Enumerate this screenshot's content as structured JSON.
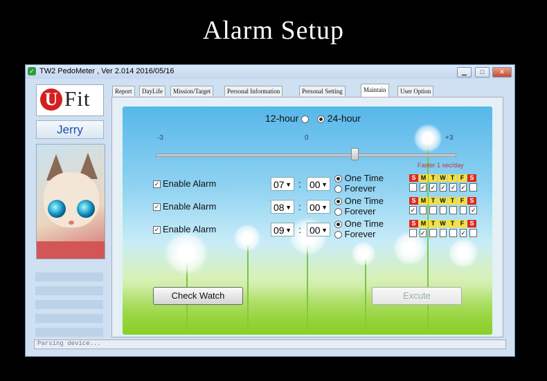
{
  "page_title": "Alarm Setup",
  "window": {
    "title": "TW2  PedoMeter , Ver 2.014   2016/05/16",
    "min_icon": "minimize-icon",
    "max_icon": "maximize-icon",
    "close_icon": "close-icon"
  },
  "sidebar": {
    "logo_u": "U",
    "logo_fit": "Fit",
    "username": "Jerry"
  },
  "tabs": [
    {
      "label": "Report"
    },
    {
      "label": "DayLife"
    },
    {
      "label": "Mission/Target"
    },
    {
      "label": "Personal Information"
    },
    {
      "label": "Personal Setting"
    },
    {
      "label": "Maintain"
    },
    {
      "label": "User Option"
    }
  ],
  "active_tab": "Maintain",
  "clock": {
    "opt_12": "12-hour",
    "opt_24": "24-hour",
    "selected": "24-hour"
  },
  "time_adjust": {
    "min_label": "-3",
    "mid_label": "0",
    "max_label": "+3",
    "value": 1,
    "hint": "Faster 1 sec/day"
  },
  "days_header": [
    "S",
    "M",
    "T",
    "W",
    "T",
    "F",
    "S"
  ],
  "alarms": [
    {
      "enable_label": "Enable Alarm",
      "enabled": true,
      "hour": "07",
      "minute": "00",
      "separator": ":",
      "one_time": "One Time",
      "forever": "Forever",
      "mode": "One Time",
      "days": [
        false,
        true,
        true,
        true,
        true,
        true,
        false
      ]
    },
    {
      "enable_label": "Enable Alarm",
      "enabled": true,
      "hour": "08",
      "minute": "00",
      "separator": ":",
      "one_time": "One Time",
      "forever": "Forever",
      "mode": "One Time",
      "days": [
        true,
        false,
        false,
        false,
        false,
        false,
        true
      ]
    },
    {
      "enable_label": "Enable Alarm",
      "enabled": true,
      "hour": "09",
      "minute": "00",
      "separator": ":",
      "one_time": "One Time",
      "forever": "Forever",
      "mode": "One Time",
      "days": [
        false,
        true,
        false,
        false,
        false,
        true,
        false
      ]
    }
  ],
  "buttons": {
    "check_watch": "Check Watch",
    "excute": "Excute"
  },
  "status": "Parsing device..."
}
